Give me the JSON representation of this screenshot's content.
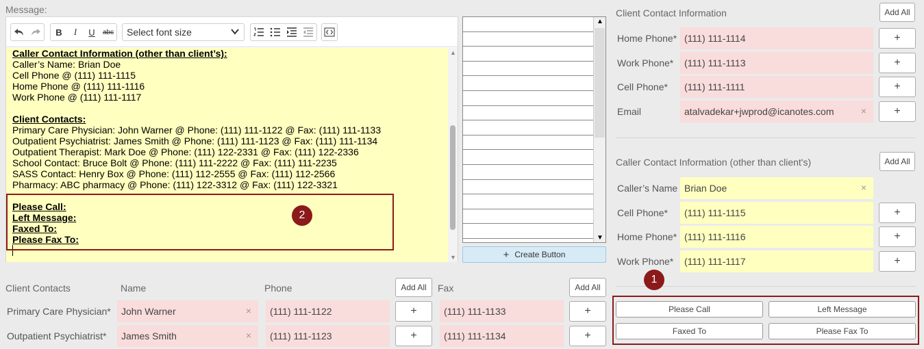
{
  "message_label": "Message:",
  "toolbar": {
    "font_size_placeholder": "Select font size"
  },
  "editor": {
    "lines": [
      {
        "text": "Caller Contact Information (other than client’s):",
        "heading": true
      },
      {
        "text": "Caller’s Name: Brian Doe"
      },
      {
        "text": "Cell Phone @ (111) 111-1115"
      },
      {
        "text": "Home Phone @ (111) 111-1116"
      },
      {
        "text": "Work Phone @ (111) 111-1117"
      },
      {
        "text": "",
        "gap": true
      },
      {
        "text": "Client Contacts:",
        "heading": true
      },
      {
        "text": "Primary Care Physician: John Warner @ Phone: (111) 111-1122 @ Fax: (111) 111-1133"
      },
      {
        "text": "Outpatient Psychiatrist: James Smith @ Phone: (111) 111-1123 @ Fax: (111) 111-1134"
      },
      {
        "text": "Outpatient Therapist: Mark Doe @ Phone: (111) 122-2331 @ Fax: (111) 122-2336"
      },
      {
        "text": "School Contact: Bruce Bolt @ Phone: (111) 111-2222 @ Fax: (111) 111-2235"
      },
      {
        "text": "SASS Contact: Henry Box @ Phone: (111) 112-2555 @ Fax: (111) 112-2566"
      },
      {
        "text": "Pharmacy: ABC pharmacy @ Phone: (111) 122-3312 @ Fax: (111) 122-3321"
      },
      {
        "text": "",
        "gap": true
      },
      {
        "text": "Please Call:",
        "heading": true
      },
      {
        "text": "Left Message:",
        "heading": true
      },
      {
        "text": "Faxed To:",
        "heading": true
      },
      {
        "text": "Please Fax To:",
        "heading": true
      }
    ]
  },
  "badges": {
    "one": "1",
    "two": "2"
  },
  "list_panel": {
    "row_count": 15
  },
  "create_button_label": "Create Button",
  "client_contact_info": {
    "title": "Client Contact Information",
    "add_all": "Add All",
    "rows": [
      {
        "label": "Home Phone*",
        "value": "(111) 111-1114"
      },
      {
        "label": "Work Phone*",
        "value": "(111) 111-1113"
      },
      {
        "label": "Cell Phone*",
        "value": "(111) 111-1111"
      },
      {
        "label": "Email",
        "value": "atalvadekar+jwprod@icanotes.com"
      }
    ]
  },
  "caller_contact_info": {
    "title": "Caller Contact Information (other than client's)",
    "add_all": "Add All",
    "rows": [
      {
        "label": "Caller’s Name",
        "value": "Brian Doe"
      },
      {
        "label": "Cell Phone*",
        "value": "(111) 111-1115"
      },
      {
        "label": "Home Phone*",
        "value": "(111) 111-1116"
      },
      {
        "label": "Work Phone*",
        "value": "(111) 111-1117"
      }
    ]
  },
  "quick_buttons": [
    "Please Call",
    "Left Message",
    "Faxed To",
    "Please Fax To"
  ],
  "client_contacts": {
    "header": {
      "title": "Client Contacts",
      "name": "Name",
      "phone": "Phone",
      "fax": "Fax",
      "add_all": "Add All"
    },
    "rows": [
      {
        "role": "Primary Care Physician*",
        "name": "John Warner",
        "phone": "(111) 111-1122",
        "fax": "(111) 111-1133"
      },
      {
        "role": "Outpatient Psychiatrist*",
        "name": "James Smith",
        "phone": "(111) 111-1123",
        "fax": "(111) 111-1134"
      }
    ]
  },
  "icons": {
    "plus": "+",
    "clear": "×"
  },
  "colors": {
    "pink_field": "#f9dcdc",
    "yellow_field": "#ffffc0",
    "highlight": "#8b1a1a",
    "create_button": "#d7ebf7"
  }
}
